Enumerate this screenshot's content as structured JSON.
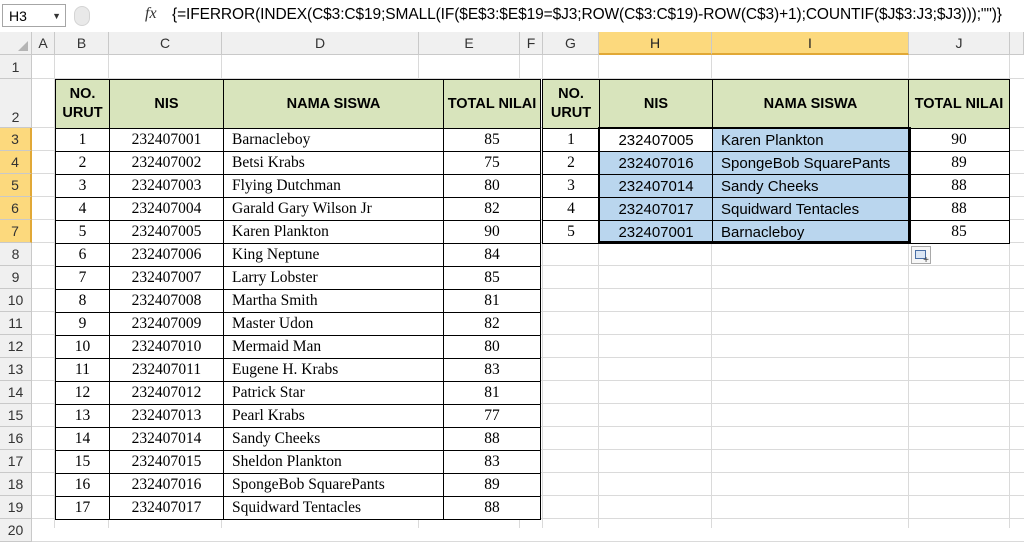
{
  "formula_bar": {
    "name_box": "H3",
    "fx_icon": "function-icon",
    "formula": "{=IFERROR(INDEX(C$3:C$19;SMALL(IF($E$3:$E$19=$J3;ROW(C$3:C$19)-ROW(C$3)+1);COUNTIF($J$3:J3;$J3)));\"\")}"
  },
  "columns": [
    "A",
    "B",
    "C",
    "D",
    "E",
    "F",
    "G",
    "H",
    "I",
    "J"
  ],
  "rows": [
    "1",
    "2",
    "3",
    "4",
    "5",
    "6",
    "7",
    "8",
    "9",
    "10",
    "11",
    "12",
    "13",
    "14",
    "15",
    "16",
    "17",
    "18",
    "19",
    "20"
  ],
  "left_table": {
    "headers": [
      "NO. URUT",
      "NIS",
      "NAMA SISWA",
      "TOTAL NILAI"
    ],
    "rows": [
      [
        "1",
        "232407001",
        "Barnacleboy",
        "85"
      ],
      [
        "2",
        "232407002",
        "Betsi Krabs",
        "75"
      ],
      [
        "3",
        "232407003",
        "Flying Dutchman",
        "80"
      ],
      [
        "4",
        "232407004",
        "Garald Gary Wilson Jr",
        "82"
      ],
      [
        "5",
        "232407005",
        "Karen Plankton",
        "90"
      ],
      [
        "6",
        "232407006",
        "King Neptune",
        "84"
      ],
      [
        "7",
        "232407007",
        "Larry Lobster",
        "85"
      ],
      [
        "8",
        "232407008",
        "Martha Smith",
        "81"
      ],
      [
        "9",
        "232407009",
        "Master Udon",
        "82"
      ],
      [
        "10",
        "232407010",
        "Mermaid Man",
        "80"
      ],
      [
        "11",
        "232407011",
        "Eugene H. Krabs",
        "83"
      ],
      [
        "12",
        "232407012",
        "Patrick Star",
        "81"
      ],
      [
        "13",
        "232407013",
        "Pearl Krabs",
        "77"
      ],
      [
        "14",
        "232407014",
        "Sandy Cheeks",
        "88"
      ],
      [
        "15",
        "232407015",
        "Sheldon Plankton",
        "83"
      ],
      [
        "16",
        "232407016",
        "SpongeBob SquarePants",
        "89"
      ],
      [
        "17",
        "232407017",
        "Squidward Tentacles",
        "88"
      ]
    ]
  },
  "right_table": {
    "headers": [
      "NO. URUT",
      "NIS",
      "NAMA SISWA",
      "TOTAL NILAI"
    ],
    "rows": [
      [
        "1",
        "232407005",
        "Karen Plankton",
        "90"
      ],
      [
        "2",
        "232407016",
        "SpongeBob SquarePants",
        "89"
      ],
      [
        "3",
        "232407014",
        "Sandy Cheeks",
        "88"
      ],
      [
        "4",
        "232407017",
        "Squidward Tentacles",
        "88"
      ],
      [
        "5",
        "232407001",
        "Barnacleboy",
        "85"
      ]
    ]
  },
  "colors": {
    "header_fill": "#d8e4bc",
    "selection_fill": "#bad6ee",
    "selected_heading": "#fcd97d"
  },
  "paste_options_icon": "paste-options-icon"
}
